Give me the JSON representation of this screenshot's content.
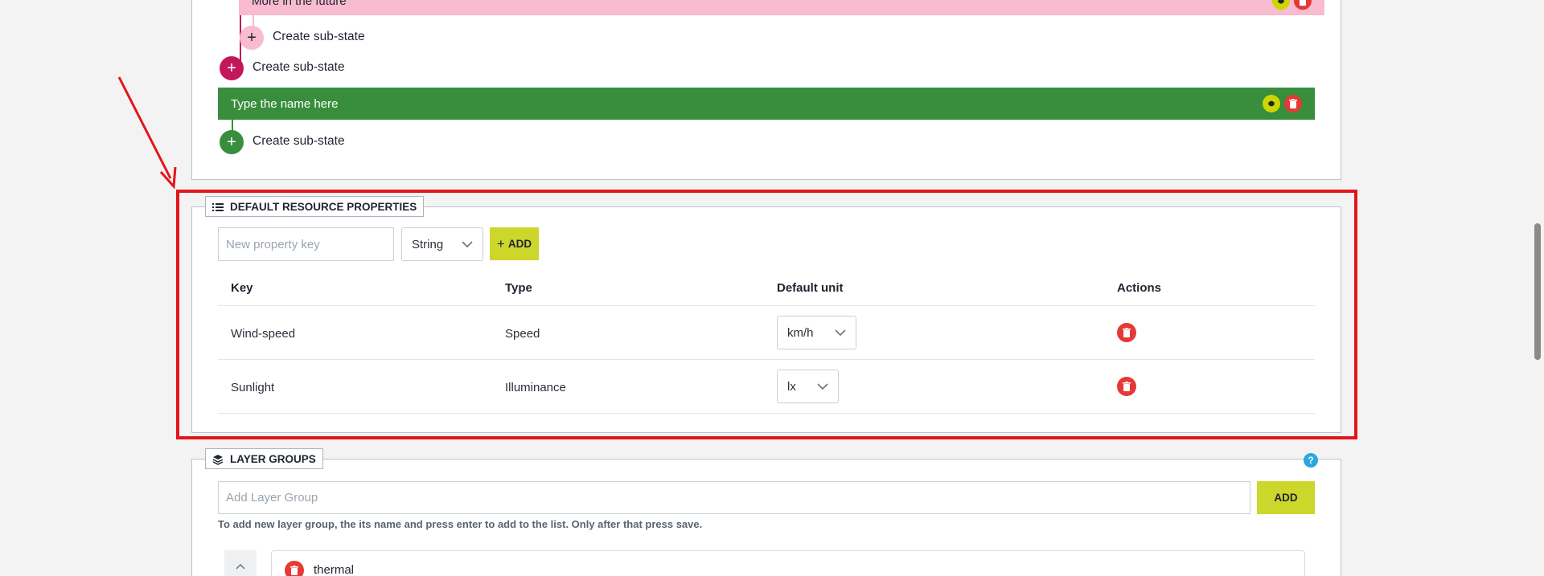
{
  "states": {
    "future_label": "More in the future",
    "future_color": "#f8bbd0",
    "create_substate_label": "Create sub-state",
    "magenta_color": "#c2185b",
    "green_state_label": "Type the name here",
    "green_color": "#388e3c"
  },
  "resource_properties": {
    "title": "DEFAULT RESOURCE PROPERTIES",
    "key_placeholder": "New property key",
    "type_selected": "String",
    "add_label": "ADD",
    "columns": [
      "Key",
      "Type",
      "Default unit",
      "Actions"
    ],
    "rows": [
      {
        "key": "Wind-speed",
        "type": "Speed",
        "unit": "km/h"
      },
      {
        "key": "Sunlight",
        "type": "Illuminance",
        "unit": "lx"
      }
    ]
  },
  "layer_groups": {
    "title": "LAYER GROUPS",
    "input_placeholder": "Add Layer Group",
    "add_label": "ADD",
    "hint": "To add new layer group, the its name and press enter to add to the list. Only after that press save.",
    "first_group": "thermal",
    "help_label": "?"
  },
  "colors": {
    "accent_lime": "#cdd62b",
    "danger": "#e53935",
    "highlight_red": "#e3151b",
    "help_blue": "#2aa7df"
  },
  "icons": [
    "gear-icon",
    "trash-icon",
    "plus-icon",
    "list-icon",
    "layers-icon",
    "chevron-down-icon",
    "chevron-up-icon",
    "help-icon",
    "arrow-annotation"
  ]
}
